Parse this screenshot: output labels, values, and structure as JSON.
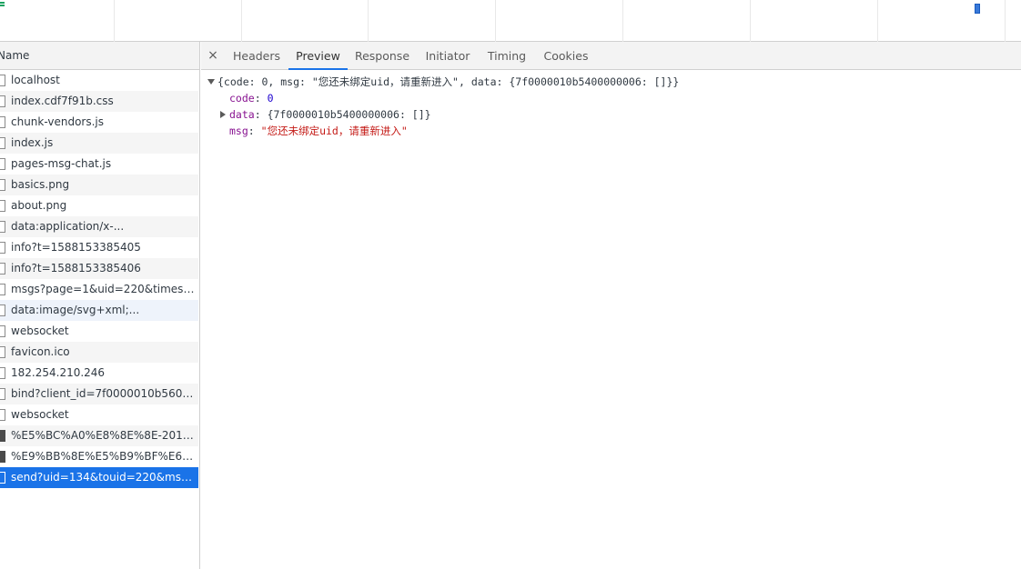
{
  "name_column": {
    "header": "Name"
  },
  "requests": [
    {
      "name": "localhost",
      "icon": "file-icon"
    },
    {
      "name": "index.cdf7f91b.css",
      "icon": "file-icon"
    },
    {
      "name": "chunk-vendors.js",
      "icon": "file-icon"
    },
    {
      "name": "index.js",
      "icon": "file-icon"
    },
    {
      "name": "pages-msg-chat.js",
      "icon": "file-icon"
    },
    {
      "name": "basics.png",
      "icon": "file-icon"
    },
    {
      "name": "about.png",
      "icon": "file-icon"
    },
    {
      "name": "data:application/x-...",
      "icon": "file-icon"
    },
    {
      "name": "info?t=1588153385405",
      "icon": "file-icon"
    },
    {
      "name": "info?t=1588153385406",
      "icon": "file-icon"
    },
    {
      "name": "msgs?page=1&uid=220&timest...",
      "icon": "file-icon"
    },
    {
      "name": "data:image/svg+xml;...",
      "icon": "file-icon"
    },
    {
      "name": "websocket",
      "icon": "file-icon"
    },
    {
      "name": "favicon.ico",
      "icon": "file-icon"
    },
    {
      "name": "182.254.210.246",
      "icon": "file-icon"
    },
    {
      "name": "bind?client_id=7f0000010b5600...",
      "icon": "file-icon"
    },
    {
      "name": "websocket",
      "icon": "file-icon"
    },
    {
      "name": "%E5%BC%A0%E8%8E%8E-20120...",
      "icon": "image-icon"
    },
    {
      "name": "%E9%BB%8E%E5%B9%BF%E6%9...",
      "icon": "image-icon"
    },
    {
      "name": "send?uid=134&touid=220&msg...",
      "icon": "file-icon"
    }
  ],
  "tabs": {
    "close": "×",
    "headers": "Headers",
    "preview": "Preview",
    "response": "Response",
    "initiator": "Initiator",
    "timing": "Timing",
    "cookies": "Cookies"
  },
  "preview": {
    "summary": "{code: 0, msg: \"您还未绑定uid，请重新进入\", data: {7f0000010b5400000006: []}}",
    "code_key": "code",
    "code_value": "0",
    "data_key": "data",
    "data_value": "{7f0000010b5400000006: []}",
    "msg_key": "msg",
    "msg_value": "\"您还未绑定uid，请重新进入\""
  },
  "colors": {
    "accent": "#1a73e8",
    "key": "#881391",
    "number": "#1c00cf",
    "string": "#c41a16"
  }
}
